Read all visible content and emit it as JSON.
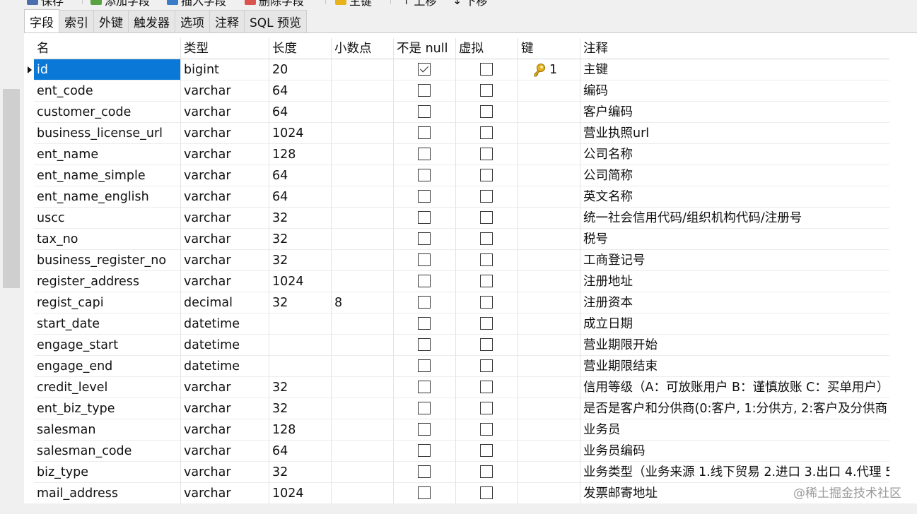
{
  "toolbar": {
    "save": "保存",
    "add_field": "添加字段",
    "insert_field": "插入字段",
    "delete_field": "删除字段",
    "primary_key": "主键",
    "move_up": "上移",
    "move_down": "下移"
  },
  "tabs": [
    "字段",
    "索引",
    "外键",
    "触发器",
    "选项",
    "注释",
    "SQL 预览"
  ],
  "columns": {
    "name": "名",
    "type": "类型",
    "length": "长度",
    "decimals": "小数点",
    "not_null": "不是 null",
    "virtual": "虚拟",
    "key": "键",
    "comment": "注释"
  },
  "rows": [
    {
      "name": "id",
      "type": "bigint",
      "length": "20",
      "decimals": "",
      "not_null": true,
      "virtual": false,
      "key": "1",
      "comment": "主键"
    },
    {
      "name": "ent_code",
      "type": "varchar",
      "length": "64",
      "decimals": "",
      "not_null": false,
      "virtual": false,
      "key": "",
      "comment": "编码"
    },
    {
      "name": "customer_code",
      "type": "varchar",
      "length": "64",
      "decimals": "",
      "not_null": false,
      "virtual": false,
      "key": "",
      "comment": "客户编码"
    },
    {
      "name": "business_license_url",
      "type": "varchar",
      "length": "1024",
      "decimals": "",
      "not_null": false,
      "virtual": false,
      "key": "",
      "comment": "营业执照url"
    },
    {
      "name": "ent_name",
      "type": "varchar",
      "length": "128",
      "decimals": "",
      "not_null": false,
      "virtual": false,
      "key": "",
      "comment": "公司名称"
    },
    {
      "name": "ent_name_simple",
      "type": "varchar",
      "length": "64",
      "decimals": "",
      "not_null": false,
      "virtual": false,
      "key": "",
      "comment": "公司简称"
    },
    {
      "name": "ent_name_english",
      "type": "varchar",
      "length": "64",
      "decimals": "",
      "not_null": false,
      "virtual": false,
      "key": "",
      "comment": "英文名称"
    },
    {
      "name": "uscc",
      "type": "varchar",
      "length": "32",
      "decimals": "",
      "not_null": false,
      "virtual": false,
      "key": "",
      "comment": "统一社会信用代码/组织机构代码/注册号"
    },
    {
      "name": "tax_no",
      "type": "varchar",
      "length": "32",
      "decimals": "",
      "not_null": false,
      "virtual": false,
      "key": "",
      "comment": "税号"
    },
    {
      "name": "business_register_no",
      "type": "varchar",
      "length": "32",
      "decimals": "",
      "not_null": false,
      "virtual": false,
      "key": "",
      "comment": "工商登记号"
    },
    {
      "name": "register_address",
      "type": "varchar",
      "length": "1024",
      "decimals": "",
      "not_null": false,
      "virtual": false,
      "key": "",
      "comment": "注册地址"
    },
    {
      "name": "regist_capi",
      "type": "decimal",
      "length": "32",
      "decimals": "8",
      "not_null": false,
      "virtual": false,
      "key": "",
      "comment": "注册资本"
    },
    {
      "name": "start_date",
      "type": "datetime",
      "length": "",
      "decimals": "",
      "not_null": false,
      "virtual": false,
      "key": "",
      "comment": "成立日期"
    },
    {
      "name": "engage_start",
      "type": "datetime",
      "length": "",
      "decimals": "",
      "not_null": false,
      "virtual": false,
      "key": "",
      "comment": "营业期限开始"
    },
    {
      "name": "engage_end",
      "type": "datetime",
      "length": "",
      "decimals": "",
      "not_null": false,
      "virtual": false,
      "key": "",
      "comment": "营业期限结束"
    },
    {
      "name": "credit_level",
      "type": "varchar",
      "length": "32",
      "decimals": "",
      "not_null": false,
      "virtual": false,
      "key": "",
      "comment": "信用等级（A：可放账用户  B：谨慎放账 C：买单用户）"
    },
    {
      "name": "ent_biz_type",
      "type": "varchar",
      "length": "32",
      "decimals": "",
      "not_null": false,
      "virtual": false,
      "key": "",
      "comment": "是否是客户和分供商(0:客户, 1:分供方, 2:客户及分供商"
    },
    {
      "name": "salesman",
      "type": "varchar",
      "length": "128",
      "decimals": "",
      "not_null": false,
      "virtual": false,
      "key": "",
      "comment": "业务员"
    },
    {
      "name": "salesman_code",
      "type": "varchar",
      "length": "64",
      "decimals": "",
      "not_null": false,
      "virtual": false,
      "key": "",
      "comment": "业务员编码"
    },
    {
      "name": "biz_type",
      "type": "varchar",
      "length": "32",
      "decimals": "",
      "not_null": false,
      "virtual": false,
      "key": "",
      "comment": "业务类型（业务来源 1.线下贸易 2.进口 3.出口 4.代理 5"
    },
    {
      "name": "mail_address",
      "type": "varchar",
      "length": "1024",
      "decimals": "",
      "not_null": false,
      "virtual": false,
      "key": "",
      "comment": "发票邮寄地址"
    }
  ],
  "watermark": "@稀土掘金技术社区",
  "colors": {
    "selection": "#0a78d7",
    "key_icon": "#e8b21c"
  }
}
